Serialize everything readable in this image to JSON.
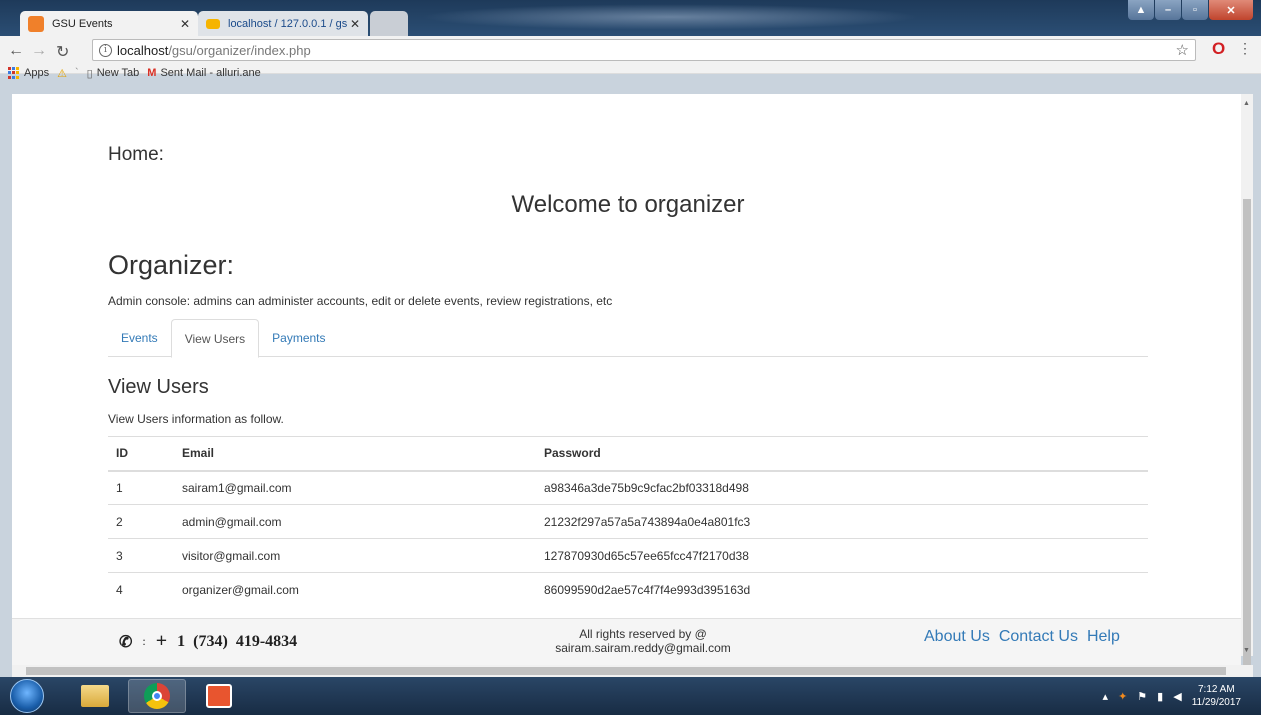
{
  "browser": {
    "tabs": [
      {
        "title": "GSU Events",
        "favicon_color": "#f0802a"
      },
      {
        "title": "localhost / 127.0.0.1 / gs",
        "favicon_color": "#f6b400"
      }
    ],
    "url_host": "localhost",
    "url_path": "/gsu/organizer/index.php",
    "bookmarks": [
      "Apps",
      "New Tab",
      "Sent Mail - alluri.ane"
    ]
  },
  "page": {
    "home_label": "Home:",
    "welcome": "Welcome to organizer",
    "organizer_title": "Organizer:",
    "organizer_desc": "Admin console: admins can administer accounts, edit or delete events, review registrations, etc",
    "tabs": [
      "Events",
      "View Users",
      "Payments"
    ],
    "active_tab": "View Users",
    "section_title": "View Users",
    "section_sub": "View Users information as follow.",
    "table": {
      "headers": [
        "ID",
        "Email",
        "Password"
      ],
      "rows": [
        [
          "1",
          "sairam1@gmail.com",
          "a98346a3de75b9c9cfac2bf03318d498"
        ],
        [
          "2",
          "admin@gmail.com",
          "21232f297a57a5a743894a0e4a801fc3"
        ],
        [
          "3",
          "visitor@gmail.com",
          "127870930d65c57ee65fcc47f2170d38"
        ],
        [
          "4",
          "organizer@gmail.com",
          "86099590d2ae57c4f7f4e993d395163d"
        ]
      ]
    }
  },
  "footer": {
    "phone_colon": ":",
    "phone_plus": "+",
    "phone_number": "1  (734)  419-4834",
    "rights_line1": "All rights reserved by @",
    "rights_line2": "sairam.sairam.reddy@gmail.com",
    "links": [
      "About Us",
      "Contact Us",
      "Help"
    ]
  },
  "taskbar": {
    "time": "7:12 AM",
    "date": "11/29/2017"
  }
}
